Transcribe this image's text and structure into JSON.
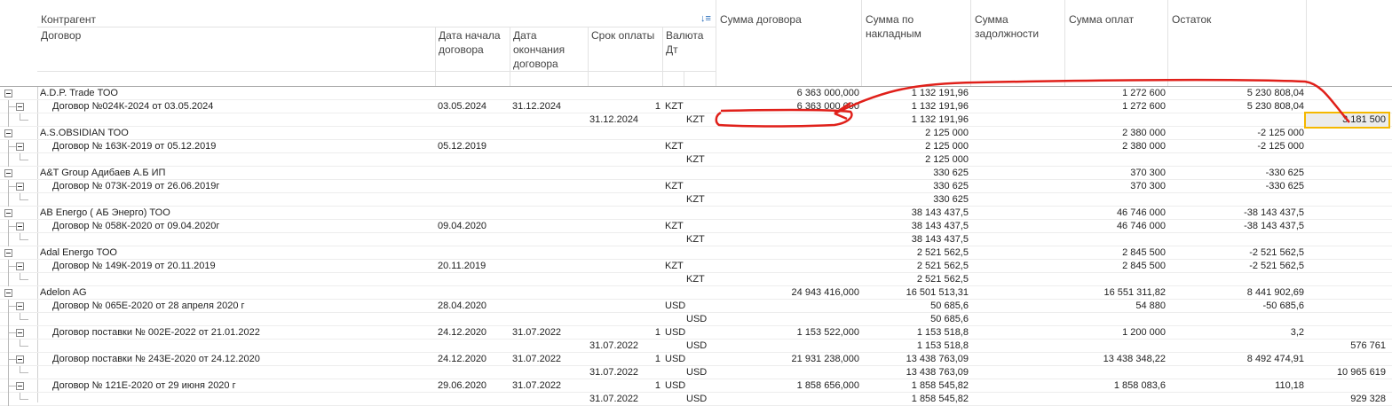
{
  "columns": {
    "counterparty": "Контрагент",
    "contract": "Договор",
    "start_date": "Дата начала договора",
    "end_date": "Дата окончания договора",
    "payment_term": "Срок оплаты",
    "currency": "Валюта Дт",
    "contract_sum": "Сумма договора",
    "invoice_sum": "Сумма по накладным",
    "debt_sum": "Сумма задолжности",
    "payment_sum": "Сумма оплат",
    "balance": "Остаток"
  },
  "icons": {
    "sort": "sort-descending-icon",
    "expand": "tree-collapse-icon"
  },
  "colors": {
    "selection_border": "#f5b800",
    "annotation": "#e0201a"
  },
  "rows": [
    {
      "level": 0,
      "name": "A.D.P. Trade ТОО",
      "contract_sum": "6 363 000,000",
      "invoice_sum": "1 132 191,96",
      "payment_sum": "1 272 600",
      "balance": "5 230 808,04"
    },
    {
      "level": 1,
      "name": "Договор №024К-2024 от 03.05.2024",
      "start": "03.05.2024",
      "end": "31.12.2024",
      "term": "1",
      "cur": "KZT",
      "contract_sum": "6 363 000,000",
      "invoice_sum": "1 132 191,96",
      "payment_sum": "1 272 600",
      "balance": "5 230 808,04"
    },
    {
      "level": 2,
      "pdate": "31.12.2024",
      "cur2": "KZT",
      "invoice_sum": "1 132 191,96",
      "extra": "3 181 500"
    },
    {
      "level": 0,
      "name": "A.S.OBSIDIAN ТОО",
      "invoice_sum": "2 125 000",
      "payment_sum": "2 380 000",
      "balance": "-2 125 000"
    },
    {
      "level": 1,
      "name": "Договор № 163К-2019 от 05.12.2019",
      "start": "05.12.2019",
      "cur": "KZT",
      "invoice_sum": "2 125 000",
      "payment_sum": "2 380 000",
      "balance": "-2 125 000"
    },
    {
      "level": 2,
      "cur2": "KZT",
      "invoice_sum": "2 125 000"
    },
    {
      "level": 0,
      "name": "A&T Group Адибаев А.Б ИП",
      "invoice_sum": "330 625",
      "payment_sum": "370 300",
      "balance": "-330 625"
    },
    {
      "level": 1,
      "name": "Договор № 073К-2019 от 26.06.2019г",
      "cur": "KZT",
      "invoice_sum": "330 625",
      "payment_sum": "370 300",
      "balance": "-330 625"
    },
    {
      "level": 2,
      "cur2": "KZT",
      "invoice_sum": "330 625"
    },
    {
      "level": 0,
      "name": "AB Energo ( АБ Энерго) ТОО",
      "invoice_sum": "38 143 437,5",
      "payment_sum": "46 746 000",
      "balance": "-38 143 437,5"
    },
    {
      "level": 1,
      "name": "Договор № 058К-2020 от 09.04.2020г",
      "start": "09.04.2020",
      "cur": "KZT",
      "invoice_sum": "38 143 437,5",
      "payment_sum": "46 746 000",
      "balance": "-38 143 437,5"
    },
    {
      "level": 2,
      "cur2": "KZT",
      "invoice_sum": "38 143 437,5"
    },
    {
      "level": 0,
      "name": "Adal Energo ТОО",
      "invoice_sum": "2 521 562,5",
      "payment_sum": "2 845 500",
      "balance": "-2 521 562,5"
    },
    {
      "level": 1,
      "name": "Договор № 149К-2019 от 20.11.2019",
      "start": "20.11.2019",
      "cur": "KZT",
      "invoice_sum": "2 521 562,5",
      "payment_sum": "2 845 500",
      "balance": "-2 521 562,5"
    },
    {
      "level": 2,
      "cur2": "KZT",
      "invoice_sum": "2 521 562,5"
    },
    {
      "level": 0,
      "name": "Adelon AG",
      "contract_sum": "24 943 416,000",
      "invoice_sum": "16 501 513,31",
      "payment_sum": "16 551 311,82",
      "balance": "8 441 902,69"
    },
    {
      "level": 1,
      "name": "Договор № 065Е-2020 от 28 апреля 2020 г",
      "start": "28.04.2020",
      "cur": "USD",
      "invoice_sum": "50 685,6",
      "payment_sum": "54 880",
      "balance": "-50 685,6"
    },
    {
      "level": 2,
      "cur2": "USD",
      "invoice_sum": "50 685,6"
    },
    {
      "level": 1,
      "name": "Договор поставки № 002Е-2022 от 21.01.2022",
      "start": "24.12.2020",
      "end": "31.07.2022",
      "term": "1",
      "cur": "USD",
      "contract_sum": "1 153 522,000",
      "invoice_sum": "1 153 518,8",
      "payment_sum": "1 200 000",
      "balance": "3,2"
    },
    {
      "level": 2,
      "pdate": "31.07.2022",
      "cur2": "USD",
      "invoice_sum": "1 153 518,8",
      "extra": "576 761"
    },
    {
      "level": 1,
      "name": "Договор поставки № 243Е-2020 от 24.12.2020",
      "start": "24.12.2020",
      "end": "31.07.2022",
      "term": "1",
      "cur": "USD",
      "contract_sum": "21 931 238,000",
      "invoice_sum": "13 438 763,09",
      "payment_sum": "13 438 348,22",
      "balance": "8 492 474,91"
    },
    {
      "level": 2,
      "pdate": "31.07.2022",
      "cur2": "USD",
      "invoice_sum": "13 438 763,09",
      "extra": "10 965 619"
    },
    {
      "level": 1,
      "name": "Договор № 121Е-2020 от 29 июня 2020 г",
      "start": "29.06.2020",
      "end": "31.07.2022",
      "term": "1",
      "cur": "USD",
      "contract_sum": "1 858 656,000",
      "invoice_sum": "1 858 545,82",
      "payment_sum": "1 858 083,6",
      "balance": "110,18"
    },
    {
      "level": 2,
      "pdate": "31.07.2022",
      "cur2": "USD",
      "invoice_sum": "1 858 545,82",
      "extra": "929 328"
    }
  ]
}
